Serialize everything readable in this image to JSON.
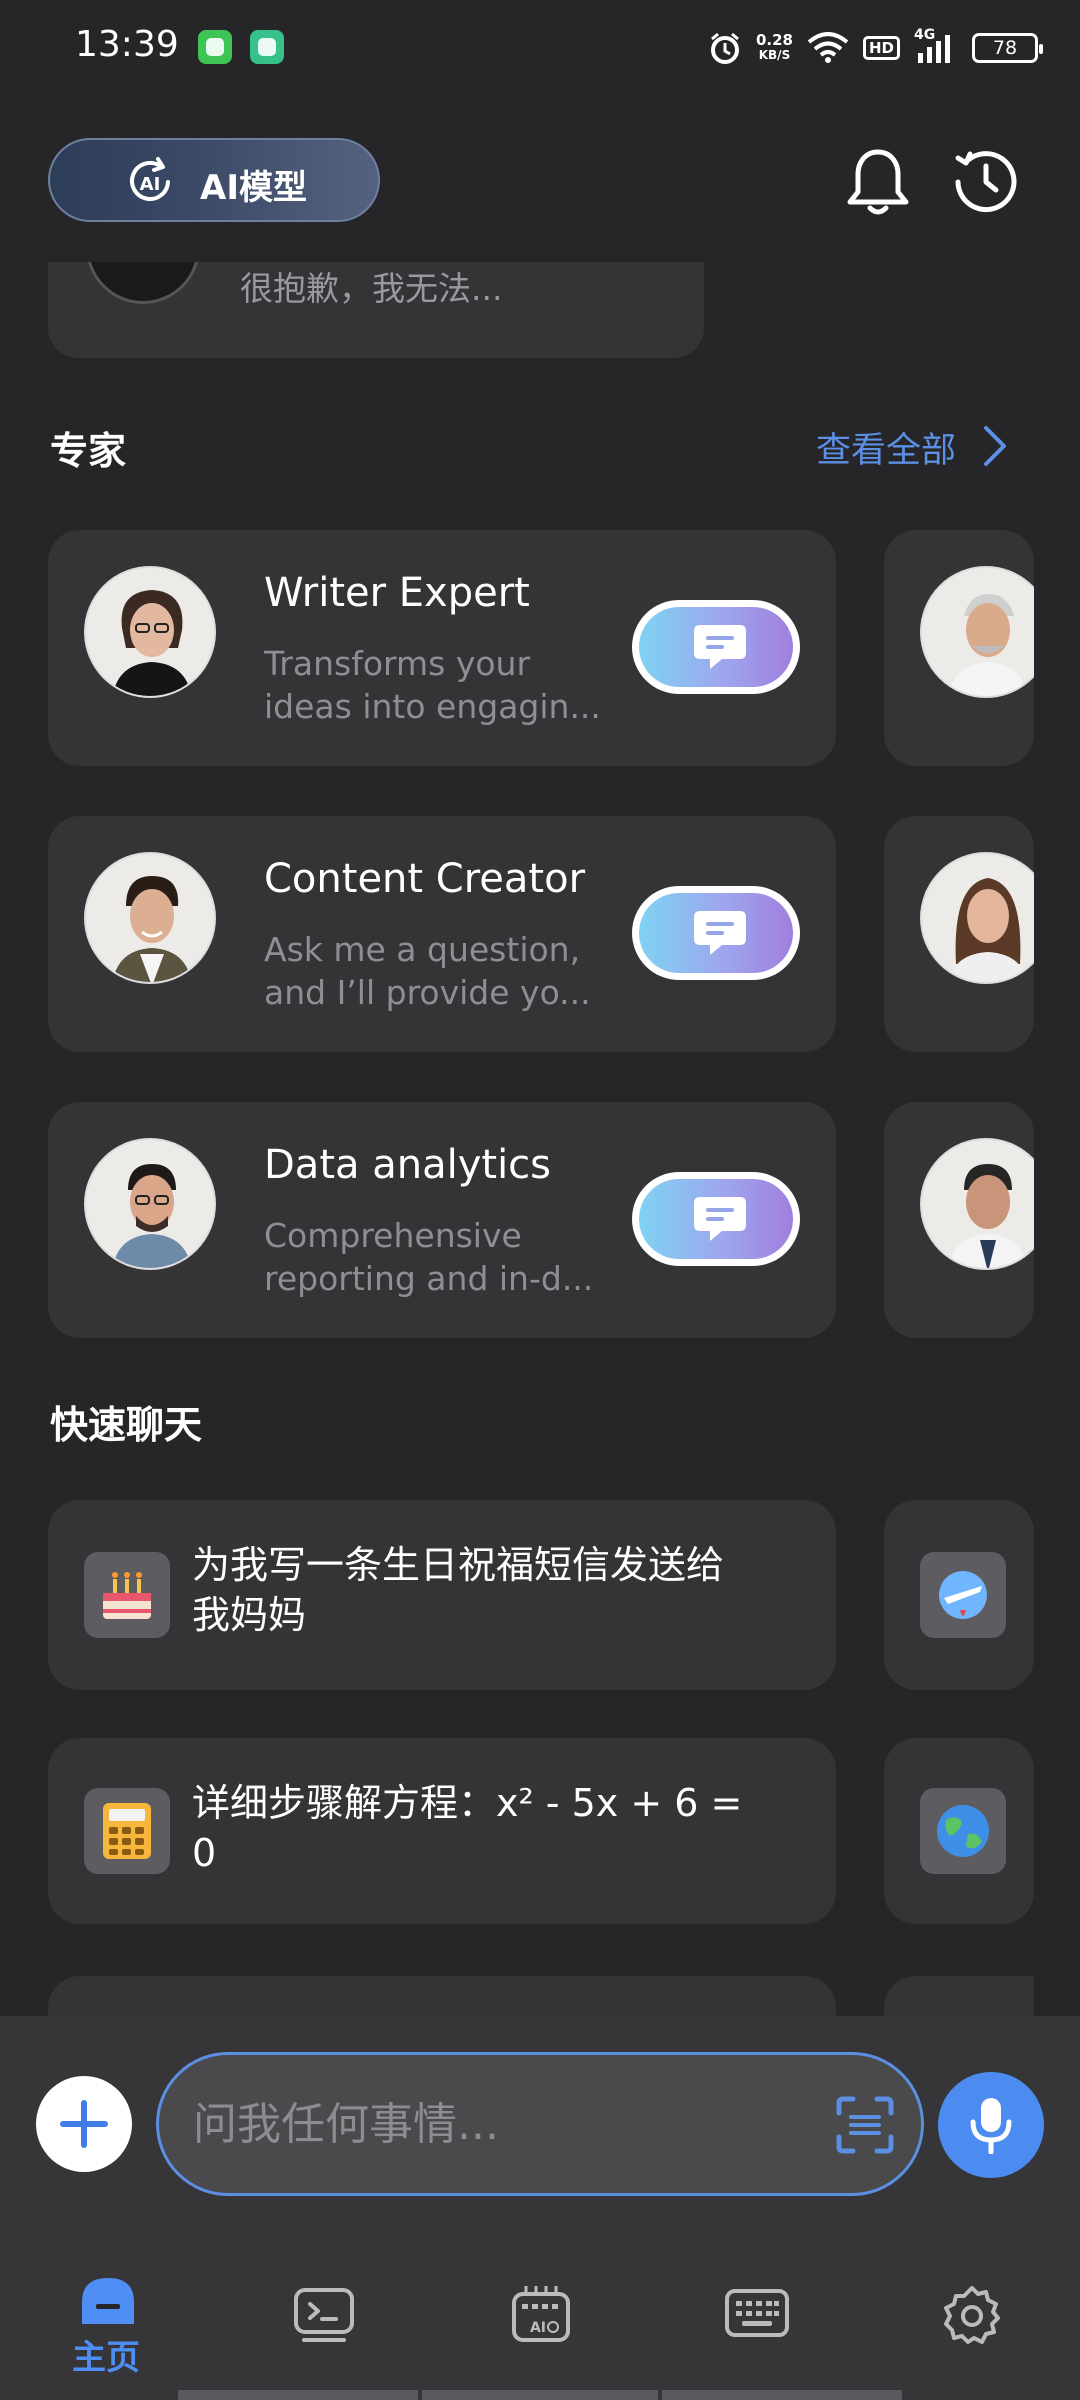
{
  "status_bar": {
    "time": "13:39",
    "speed_value": "0.28",
    "speed_unit": "KB/S",
    "hd": "HD",
    "network": "4G",
    "battery": "78"
  },
  "header": {
    "model_label": "AI模型",
    "ai_icon_text": "AI"
  },
  "recent": {
    "preview_text": "很抱歉，我无法..."
  },
  "experts": {
    "section_title": "专家",
    "view_all": "查看全部",
    "items": [
      {
        "title": "Writer Expert",
        "desc_line1": "Transforms your",
        "desc_line2": "ideas into engagin..."
      },
      {
        "title": "Content Creator",
        "desc_line1": "Ask me a question,",
        "desc_line2": "and I’ll provide yo..."
      },
      {
        "title": "Data analytics",
        "desc_line1": "Comprehensive",
        "desc_line2": "reporting and in-d..."
      }
    ]
  },
  "quick_chat": {
    "section_title": "快速聊天",
    "items": [
      {
        "line1": "为我写一条生日祝福短信发送给",
        "line2": "我妈妈",
        "icon": "birthday-cake-icon"
      },
      {
        "line1": "详细步骤解方程：x² - 5x + 6 =",
        "line2": "0",
        "icon": "calculator-icon"
      }
    ]
  },
  "input": {
    "placeholder": "问我任何事情..."
  },
  "tabs": {
    "home_label": "主页"
  },
  "colors": {
    "accent": "#4f8ef4",
    "background": "#262527",
    "card": "#343336"
  }
}
